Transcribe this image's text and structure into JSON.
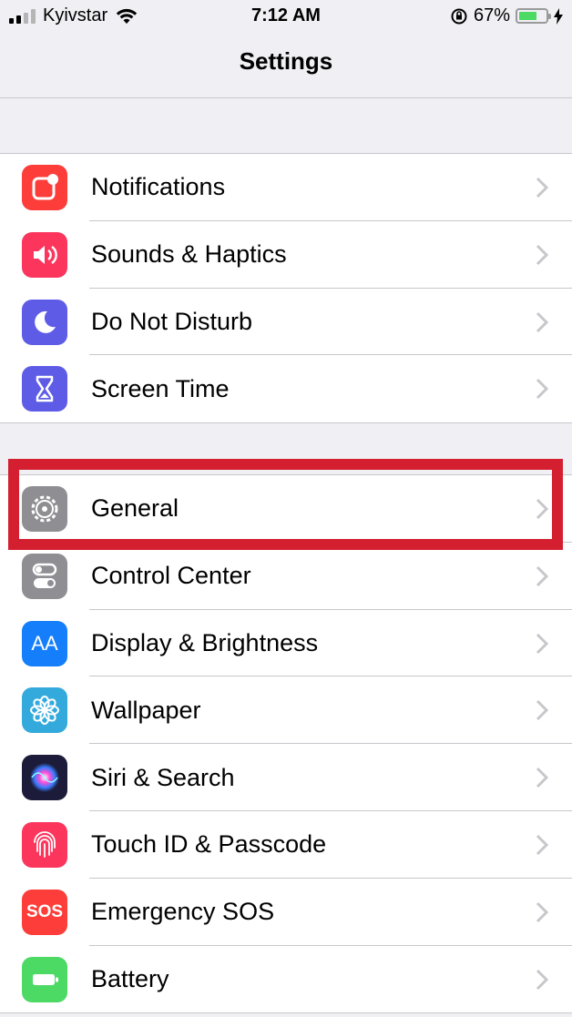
{
  "status_bar": {
    "carrier": "Kyivstar",
    "time": "7:12 AM",
    "battery_percent": "67%",
    "battery_level": 0.67,
    "signal_bars_filled": 2,
    "colors": {
      "battery_fill": "#4cd964"
    }
  },
  "nav": {
    "title": "Settings"
  },
  "groups": [
    {
      "items": [
        {
          "label": "Notifications",
          "icon": "notifications-icon",
          "color": "#fc3d39"
        },
        {
          "label": "Sounds & Haptics",
          "icon": "speaker-icon",
          "color": "#fc355d"
        },
        {
          "label": "Do Not Disturb",
          "icon": "moon-icon",
          "color": "#5e5ce6"
        },
        {
          "label": "Screen Time",
          "icon": "hourglass-icon",
          "color": "#5e5ce6"
        }
      ]
    },
    {
      "items": [
        {
          "label": "General",
          "icon": "gear-icon",
          "color": "#8e8e93",
          "highlighted": true
        },
        {
          "label": "Control Center",
          "icon": "toggles-icon",
          "color": "#8e8e93"
        },
        {
          "label": "Display & Brightness",
          "icon": "text-size-icon",
          "color": "#147efb",
          "glyph": "AA"
        },
        {
          "label": "Wallpaper",
          "icon": "flower-icon",
          "color": "#34aadc"
        },
        {
          "label": "Siri & Search",
          "icon": "siri-icon",
          "color": "#1c1c3a"
        },
        {
          "label": "Touch ID & Passcode",
          "icon": "fingerprint-icon",
          "color": "#fc355d"
        },
        {
          "label": "Emergency SOS",
          "icon": "sos-icon",
          "color": "#fc3d39",
          "glyph": "SOS"
        },
        {
          "label": "Battery",
          "icon": "battery-icon",
          "color": "#4cd964"
        }
      ]
    }
  ],
  "highlight_color": "#d31f2f"
}
